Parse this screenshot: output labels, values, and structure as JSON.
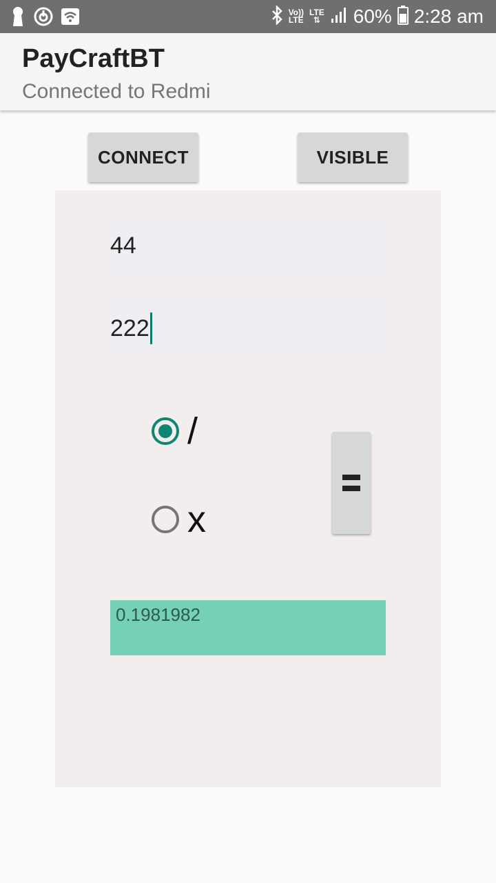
{
  "status_bar": {
    "icons_left": [
      "keyhole-icon",
      "power-timer-icon",
      "wifi-icon"
    ],
    "icons_right": [
      "bluetooth-icon",
      "volte-icon",
      "lte-icon",
      "signal-icon",
      "battery-icon"
    ],
    "volte_label_1": "Vo))",
    "volte_label_2": "LTE",
    "lte_label": "LTE",
    "battery": "60%",
    "time": "2:28 am"
  },
  "app_bar": {
    "title": "PayCraftBT",
    "subtitle": "Connected to Redmi"
  },
  "buttons": {
    "connect": "CONNECT",
    "visible": "VISIBLE"
  },
  "form": {
    "field1_value": "44",
    "field2_value": "222",
    "radio_divide_label": "/",
    "radio_multiply_label": "x",
    "selected": "divide",
    "equals_icon": "equals-icon",
    "result": "0.1981982"
  },
  "colors": {
    "accent": "#0f8574",
    "result_bg": "#76d0b6",
    "status_bar": "#6f6f6f",
    "panel": "#f3eeee"
  }
}
